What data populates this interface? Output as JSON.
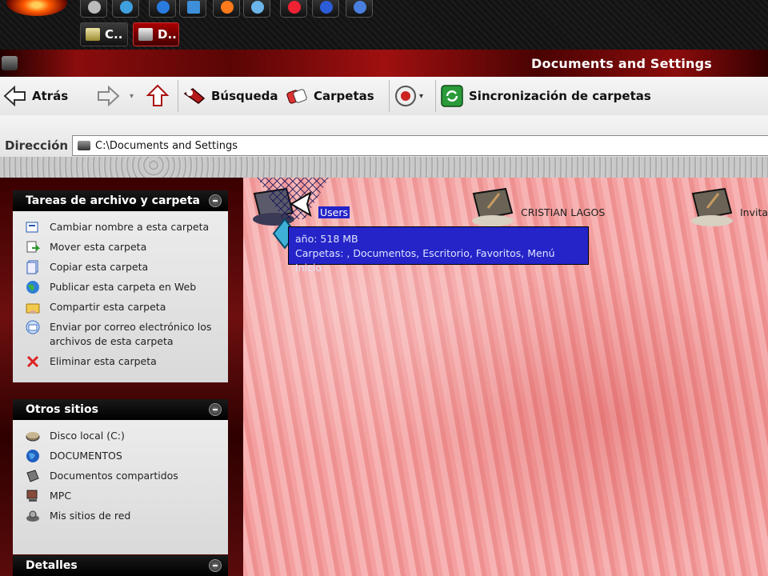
{
  "taskbar": {
    "tasks": [
      {
        "label": "C.."
      },
      {
        "label": "D.."
      }
    ]
  },
  "window": {
    "title": "Documents and Settings"
  },
  "toolbar": {
    "back_label": "Atrás",
    "search_label": "Búsqueda",
    "folders_label": "Carpetas",
    "sync_label": "Sincronización de carpetas"
  },
  "address": {
    "label": "Dirección",
    "value": "C:\\Documents and Settings"
  },
  "tasks_panel": {
    "title": "Tareas de archivo y carpeta",
    "items": [
      {
        "label": "Cambiar nombre a esta carpeta"
      },
      {
        "label": "Mover esta carpeta"
      },
      {
        "label": "Copiar esta carpeta"
      },
      {
        "label": "Publicar esta carpeta en Web"
      },
      {
        "label": "Compartir esta carpeta"
      },
      {
        "label": "Enviar por correo electrónico los archivos de esta carpeta"
      },
      {
        "label": "Eliminar esta carpeta"
      }
    ]
  },
  "other_places": {
    "title": "Otros sitios",
    "items": [
      {
        "label": "Disco local (C:)"
      },
      {
        "label": "DOCUMENTOS"
      },
      {
        "label": "Documentos compartidos"
      },
      {
        "label": "MPC"
      },
      {
        "label": "Mis sitios de red"
      }
    ]
  },
  "details": {
    "title": "Detalles"
  },
  "content": {
    "folders": [
      {
        "label": "Users"
      },
      {
        "label": "CRISTIAN LAGOS"
      },
      {
        "label": "Invita"
      }
    ],
    "tooltip": {
      "line1": "año: 518 MB",
      "line2": "Carpetas: , Documentos, Escritorio, Favoritos, Menú Inicio"
    }
  }
}
